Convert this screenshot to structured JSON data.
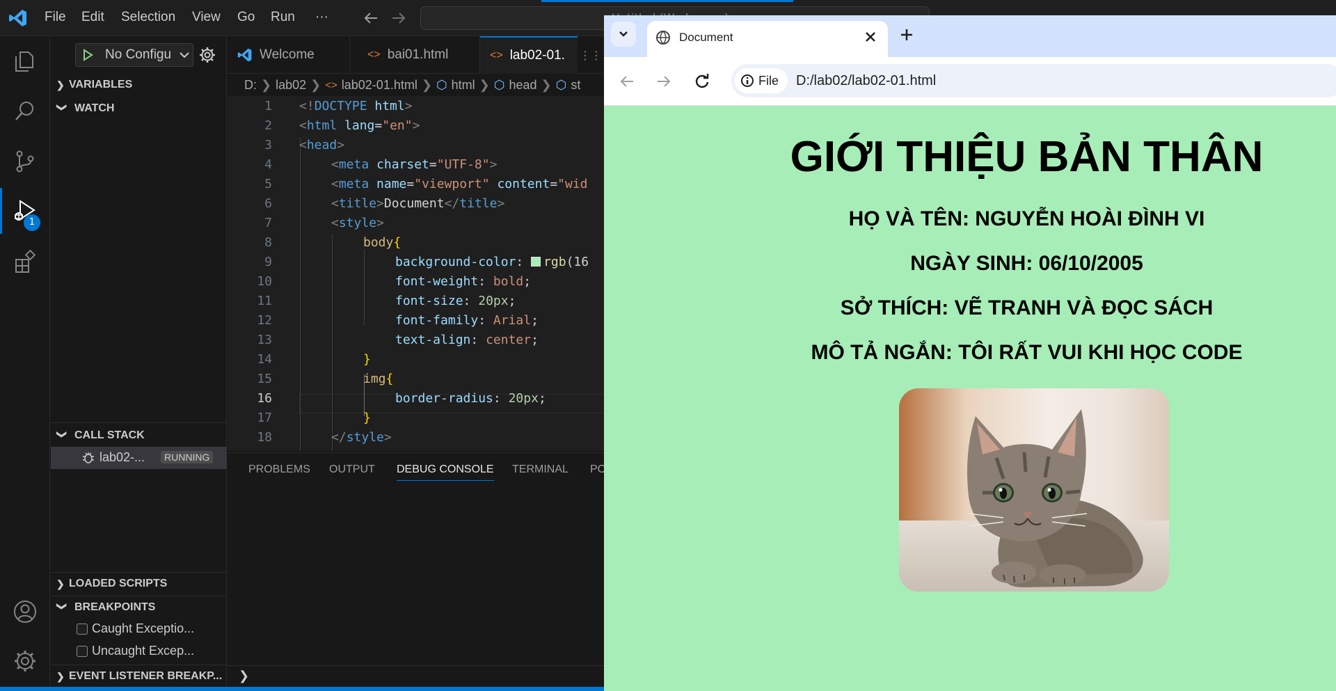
{
  "menu": [
    "File",
    "Edit",
    "Selection",
    "View",
    "Go",
    "Run",
    "···"
  ],
  "command_center": {
    "text": "Untitled (Workspace)"
  },
  "activity": {
    "debug_badge": "1"
  },
  "run_config": {
    "label": "No Configu"
  },
  "sidebar": {
    "variables": "VARIABLES",
    "watch": "WATCH",
    "call_stack": "CALL STACK",
    "stack_item": "lab02-...",
    "stack_status": "RUNNING",
    "loaded_scripts": "LOADED SCRIPTS",
    "breakpoints": "BREAKPOINTS",
    "bp_caught": "Caught Exceptio...",
    "bp_uncaught": "Uncaught Excep...",
    "event_listener": "EVENT LISTENER BREAKP..."
  },
  "tabs": [
    "Welcome",
    "bai01.html",
    "lab02-01."
  ],
  "breadcrumb": [
    "D:",
    "lab02",
    "lab02-01.html",
    "html",
    "head",
    "st"
  ],
  "code": {
    "line_numbers": [
      "1",
      "2",
      "3",
      "4",
      "5",
      "6",
      "7",
      "8",
      "9",
      "10",
      "11",
      "12",
      "13",
      "14",
      "15",
      "16",
      "17",
      "18"
    ],
    "l1a": "<!",
    "l1b": "DOCTYPE",
    "l1c": " html",
    "l1d": ">",
    "l2a": "<",
    "l2b": "html",
    "l2c": " lang",
    "l2d": "=",
    "l2e": "\"en\"",
    "l2f": ">",
    "l3a": "<",
    "l3b": "head",
    "l3c": ">",
    "l4a": "<",
    "l4b": "meta",
    "l4c": " charset",
    "l4d": "=",
    "l4e": "\"UTF-8\"",
    "l4f": ">",
    "l5a": "<",
    "l5b": "meta",
    "l5c": " name",
    "l5d": "=",
    "l5e": "\"viewport\"",
    "l5f": " content",
    "l5g": "=",
    "l5h": "\"wid",
    "l6a": "<",
    "l6b": "title",
    "l6c": ">",
    "l6d": "Document",
    "l6e": "</",
    "l6f": "title",
    "l6g": ">",
    "l7a": "<",
    "l7b": "style",
    "l7c": ">",
    "l8a": "body",
    "l8b": "{",
    "l9a": "background-color",
    "l9b": ": ",
    "l9c": "rgb",
    "l9d": "(16",
    "l10a": "font-weight",
    "l10b": ": ",
    "l10c": "bold",
    "l10d": ";",
    "l11a": "font-size",
    "l11b": ": ",
    "l11c": "20px",
    "l11d": ";",
    "l12a": "font-family",
    "l12b": ": ",
    "l12c": "Arial",
    "l12d": ";",
    "l13a": "text-align",
    "l13b": ": ",
    "l13c": "center",
    "l13d": ";",
    "l14a": "}",
    "l15a": "img",
    "l15b": "{",
    "l16a": "border-radius",
    "l16b": ": ",
    "l16c": "20px",
    "l16d": ";",
    "l17a": "}",
    "l18a": "</",
    "l18b": "style",
    "l18c": ">"
  },
  "panel_tabs": [
    "PROBLEMS",
    "OUTPUT",
    "DEBUG CONSOLE",
    "TERMINAL",
    "PO"
  ],
  "browser": {
    "tab_title": "Document",
    "file_chip": "File",
    "url": "D:/lab02/lab02-01.html"
  },
  "webpage": {
    "heading": "GIỚI THIỆU BẢN THÂN",
    "name": "HỌ VÀ TÊN: NGUYỄN HOÀI ĐÌNH VI",
    "dob": "NGÀY SINH: 06/10/2005",
    "hobby": "SỞ THÍCH: VẼ TRANH VÀ ĐỌC SÁCH",
    "desc": "MÔ TẢ NGẮN: TÔI RẤT VUI KHI HỌC CODE"
  },
  "colors": {
    "page_bg": "#a7edb7",
    "accent": "#0078d4",
    "editor_bg": "#1f1f1f"
  }
}
